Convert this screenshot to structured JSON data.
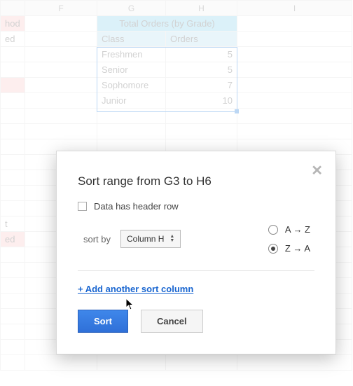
{
  "columns": {
    "f": "F",
    "g": "G",
    "h": "H",
    "i": "I"
  },
  "cells": {
    "stub_hod": "hod",
    "stub_ed": "ed",
    "stub_t": "t",
    "stub_ed2": "ed",
    "merged_title": "Total Orders (by Grade)",
    "hdr_class": "Class",
    "hdr_orders": "Orders",
    "r1c1": "Freshmen",
    "r1c2": "5",
    "r2c1": "Senior",
    "r2c2": "5",
    "r3c1": "Sophomore",
    "r3c2": "7",
    "r4c1": "Junior",
    "r4c2": "10"
  },
  "chart_data": {
    "type": "table",
    "title": "Total Orders (by Grade)",
    "columns": [
      "Class",
      "Orders"
    ],
    "rows": [
      [
        "Freshmen",
        5
      ],
      [
        "Senior",
        5
      ],
      [
        "Sophomore",
        7
      ],
      [
        "Junior",
        10
      ]
    ]
  },
  "dialog": {
    "title": "Sort range from G3 to H6",
    "header_checkbox_label": "Data has header row",
    "sort_by_label": "sort by",
    "sort_column": "Column H",
    "radio_asc": "A → Z",
    "radio_desc": "Z → A",
    "add_link": "+ Add another sort column",
    "sort_btn": "Sort",
    "cancel_btn": "Cancel"
  }
}
